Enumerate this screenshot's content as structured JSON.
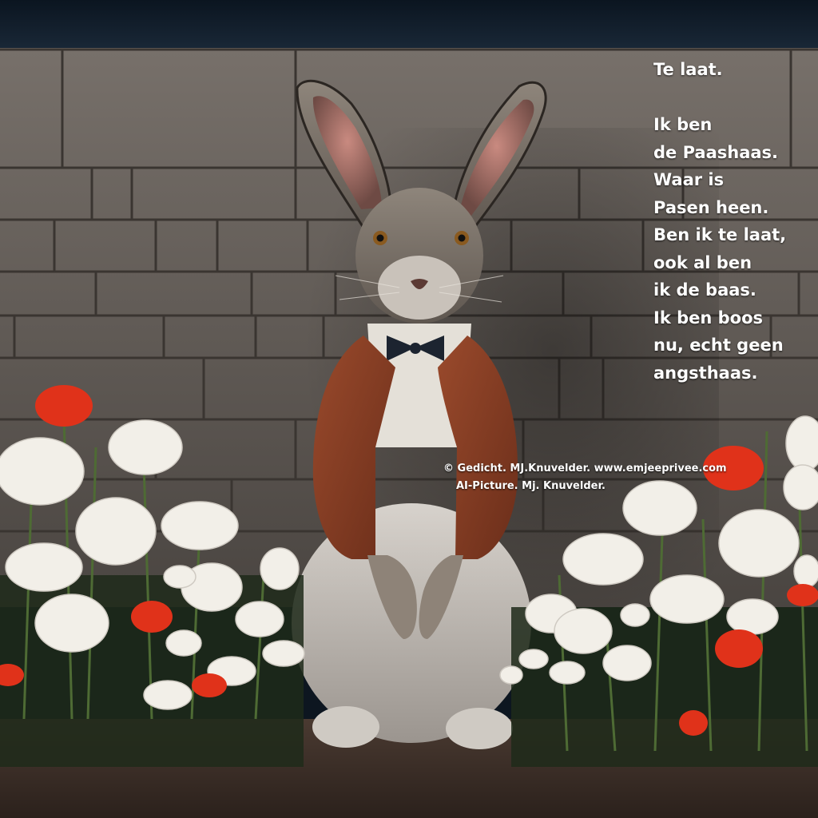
{
  "poem": {
    "title": "Te laat.",
    "lines": [
      "Ik ben",
      "de Paashaas.",
      "Waar is",
      "Pasen heen.",
      "Ben ik te laat,",
      "ook al ben",
      "ik de baas.",
      "Ik ben boos",
      "nu, echt geen",
      "angsthaas."
    ]
  },
  "credits": {
    "line1": "© Gedicht. MJ.Knuvelder. www.emjeeprivee.com",
    "line2": "AI-Picture. Mj. Knuvelder."
  },
  "colors": {
    "sky": "#0f1b29",
    "wall": "#6b645d",
    "jacket": "#8a3f24",
    "poppy_red": "#e0321a",
    "poppy_white": "#f2efe8",
    "ground": "#3d2f28"
  }
}
